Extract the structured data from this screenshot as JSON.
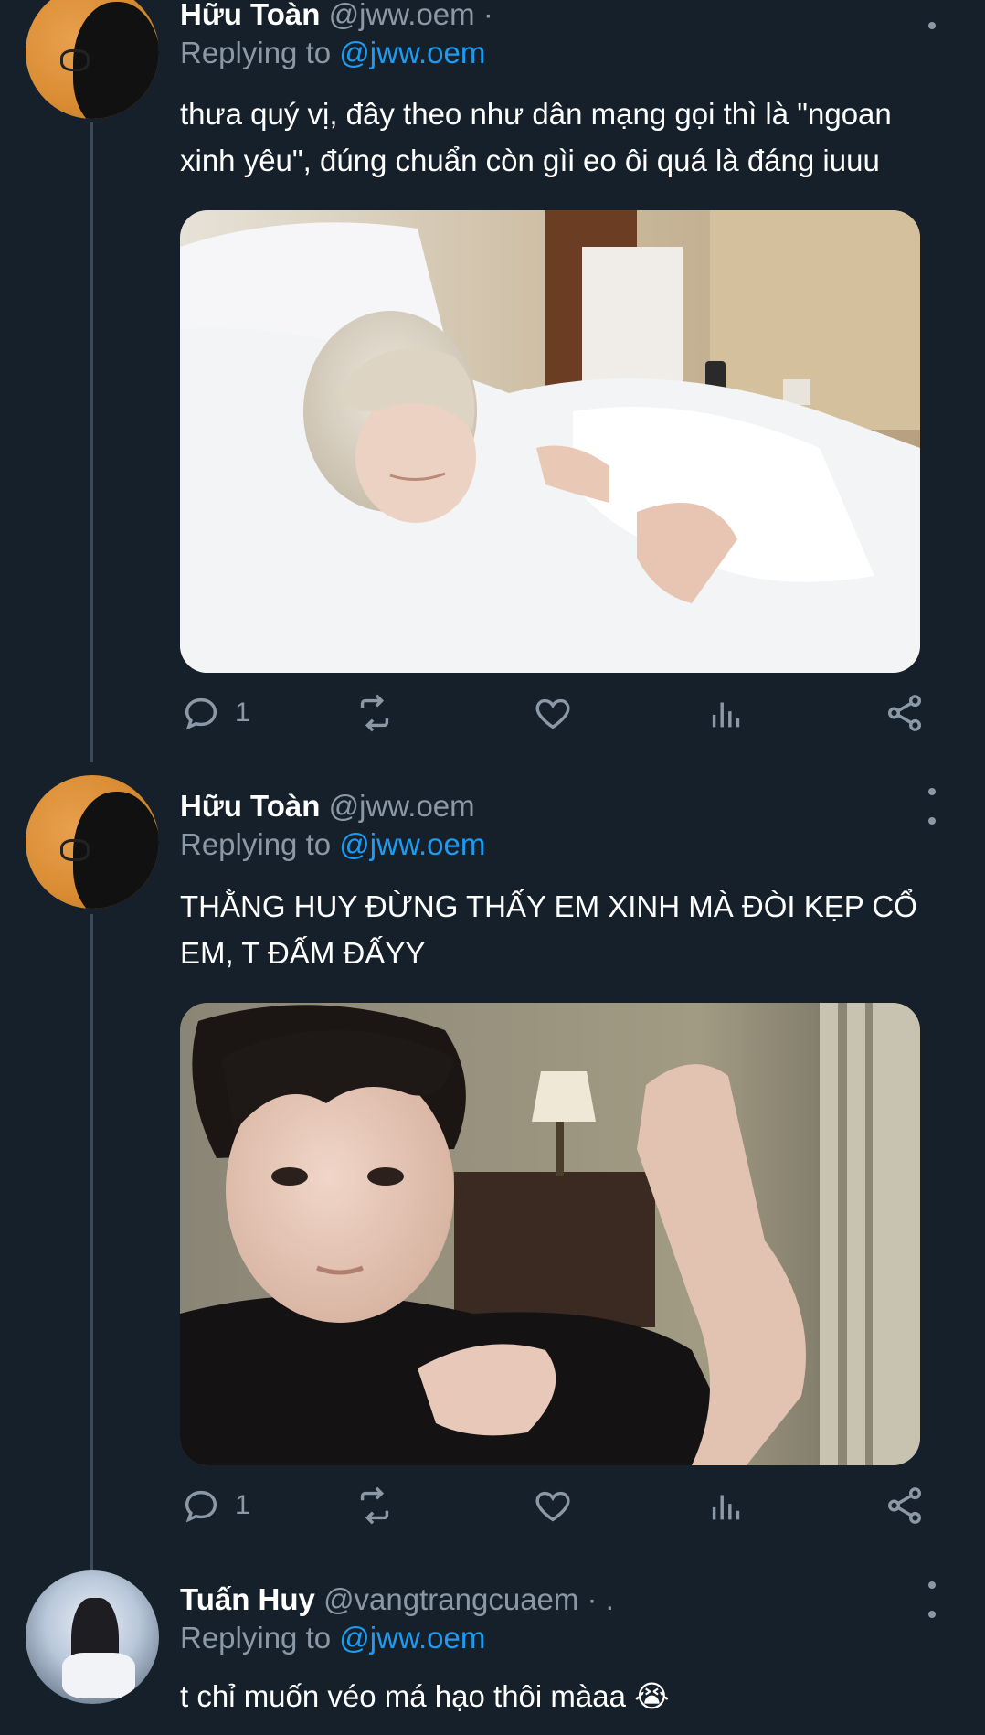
{
  "tweets": [
    {
      "name": "Hữu Toàn",
      "handle": "@jww.oem ·",
      "replying_prefix": "Replying to",
      "replying_mention": "@jww.oem",
      "text": "thưa quý vị, đây theo như dân mạng gọi thì là \"ngoan xinh yêu\", đúng chuẩn còn gìi eo ôi quá là đáng iuuu",
      "reply_count": "1",
      "avatar_icon": "silhouette-avatar",
      "media": "photo of a blond person sleeping in white hotel bed sheets"
    },
    {
      "name": "Hữu Toàn",
      "handle": "@jww.oem",
      "replying_prefix": "Replying to",
      "replying_mention": "@jww.oem",
      "text": "THẰNG HUY ĐỪNG THẤY EM XINH MÀ ĐÒI KẸP CỔ EM, T ĐẤM ĐẤYY",
      "reply_count": "1",
      "avatar_icon": "silhouette-avatar",
      "media": "photo of a dark-haired person in black shirt raising a fist in a hotel room"
    },
    {
      "name": "Tuấn Huy",
      "handle": "@vangtrangcuaem · .",
      "replying_prefix": "Replying to",
      "replying_mention": "@jww.oem",
      "text": "t chỉ muốn véo má hạo thôi màaa 😭",
      "avatar_icon": "photo-avatar"
    }
  ],
  "icons": [
    "reply-icon",
    "retweet-icon",
    "like-icon",
    "views-icon",
    "share-icon",
    "more-icon"
  ],
  "colors": {
    "background": "#15202b",
    "secondary": "#8b98a5",
    "accent": "#1d9bf0",
    "thread_line": "#3d4a57"
  }
}
